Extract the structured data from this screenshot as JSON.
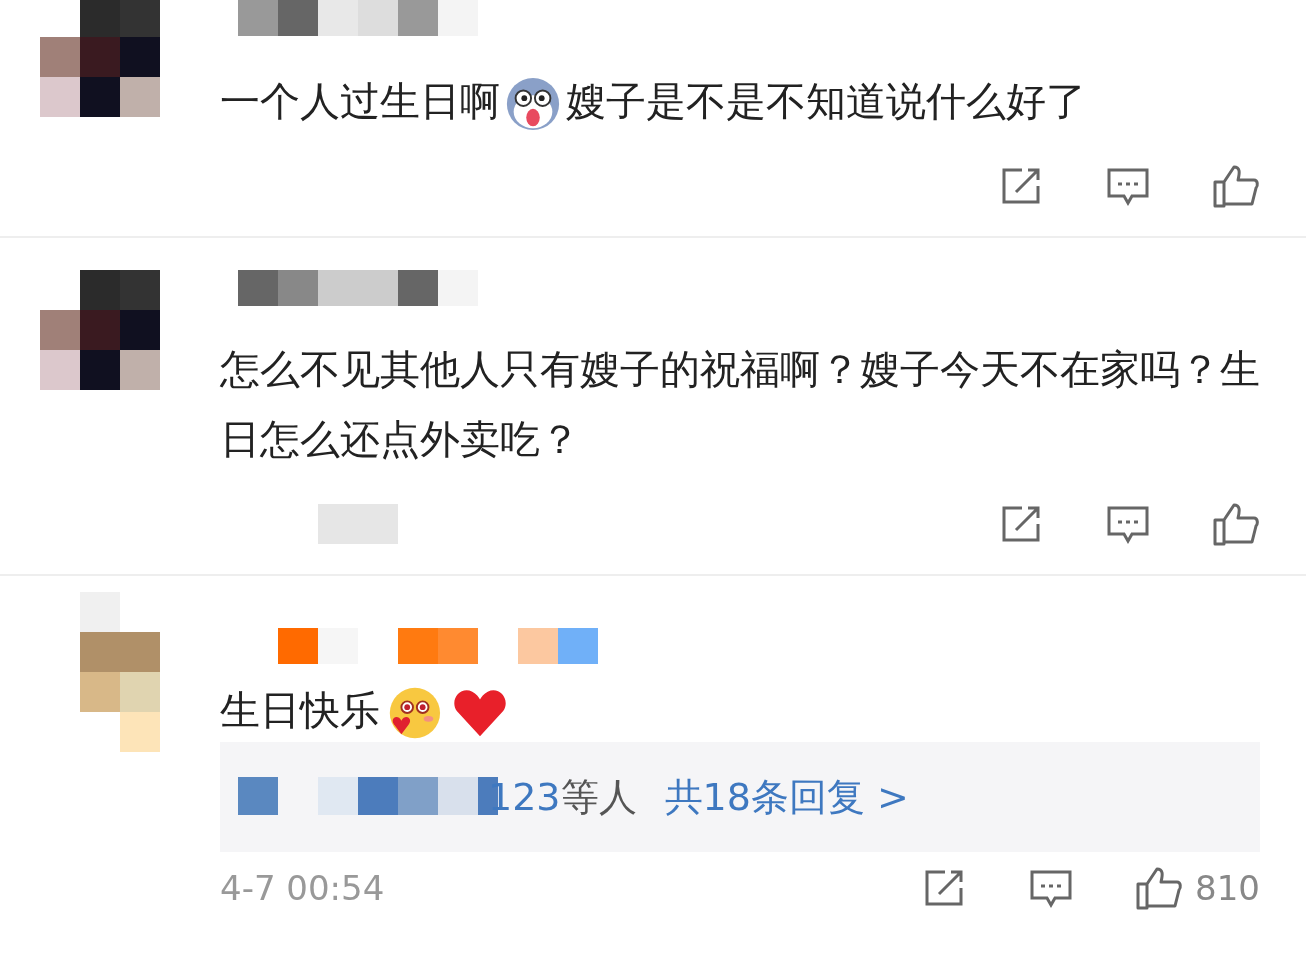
{
  "comments": [
    {
      "segments": [
        {
          "kind": "text",
          "text": "一个人过生日啊"
        },
        {
          "kind": "dog"
        },
        {
          "kind": "text",
          "text": "嫂子是不是不知道说什么好了"
        }
      ]
    },
    {
      "segments": [
        {
          "kind": "text",
          "text": "怎么不见其他人只有嫂子的祝福啊？嫂子今天不在家吗？生日怎么还点外卖吃？"
        }
      ]
    },
    {
      "segments": [
        {
          "kind": "text",
          "text": "生日快乐"
        },
        {
          "kind": "blush"
        },
        {
          "kind": "heart"
        }
      ],
      "replies": {
        "count_tail": "123",
        "suffix": "等人",
        "link": "共18条回复 >"
      },
      "time": "4-7 00:54",
      "likes": "810"
    }
  ]
}
